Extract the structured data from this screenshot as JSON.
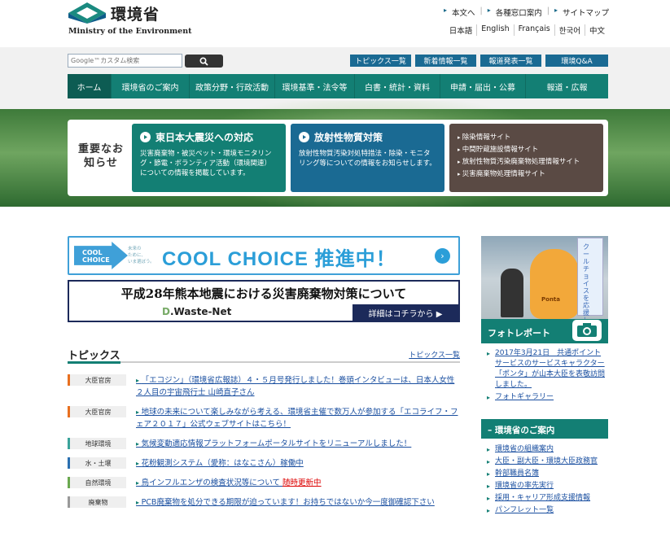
{
  "header": {
    "logo_jp": "環境省",
    "logo_en": "Ministry of the Environment",
    "top_links": [
      "本文へ",
      "各種窓口案内",
      "サイトマップ"
    ],
    "languages": [
      "日本語",
      "English",
      "Français",
      "한국어",
      "中文"
    ]
  },
  "search": {
    "placeholder": "Google™カスタム検索"
  },
  "quick_buttons": [
    "トピックス一覧",
    "新着情報一覧",
    "報道発表一覧",
    "環境Q&A"
  ],
  "nav": {
    "items": [
      "ホーム",
      "環境省のご案内",
      "政策分野・行政活動",
      "環境基準・法令等",
      "白書・統計・資料",
      "申請・届出・公募",
      "報道・広報"
    ]
  },
  "notice": {
    "label": "重要なお知らせ",
    "cards": [
      {
        "title": "東日本大震災への対応",
        "desc": "災害廃棄物・被災ペット・環境モニタリング・節電・ボランティア活動（環境関連）についての情報を掲載しています。",
        "color": "#137f74"
      },
      {
        "title": "放射性物質対策",
        "desc": "放射性物質汚染対処特措法・除染・モニタリング等についての情報をお知らせします。",
        "color": "#1a6a93"
      }
    ],
    "links": [
      "除染情報サイト",
      "中間貯蔵施設情報サイト",
      "放射性物質汚染廃棄物処理情報サイト",
      "災害廃棄物処理情報サイト"
    ],
    "links_color": "#5a4a44"
  },
  "cool_choice": {
    "arrow_text_1": "COOL",
    "arrow_text_2": "CHOICE",
    "small_1": "未来の",
    "small_2": "ために、",
    "small_3": "いま選ぼう。",
    "headline": "COOL CHOICE 推進中！"
  },
  "quake_banner": {
    "title": "平成28年熊本地震における災害廃棄物対策について",
    "logo_d": "D",
    "logo_rest": ".Waste-Net",
    "detail": "詳細はコチラから ▶"
  },
  "topics": {
    "heading": "トピックス",
    "all_link": "トピックス一覧",
    "items": [
      {
        "tag": "大臣官房",
        "text": "「エコジン」（環境省広報誌）４・５月号発行しました！巻頭インタビューは、日本人女性２人目の宇宙飛行士 山崎直子さん",
        "tag_color": "#e87020"
      },
      {
        "tag": "大臣官房",
        "text": "地球の未来について楽しみながら考える、環境省主催で数万人が参加する「エコライフ・フェア２０１７」公式ウェブサイトはこちら！",
        "tag_color": "#e87020"
      },
      {
        "tag": "地球環境",
        "text": "気候変動適応情報プラットフォームポータルサイトをリニューアルしました！",
        "tag_color": "#3aa39a"
      },
      {
        "tag": "水・土壌",
        "text": "花粉観測システム（愛称：はなこさん）稼働中",
        "tag_color": "#2a6fb0"
      },
      {
        "tag": "自然環境",
        "text": "鳥インフルエンザの検査状況等について",
        "extra": "随時更新中",
        "tag_color": "#6aa84f"
      },
      {
        "tag": "廃棄物",
        "text": "PCB廃棄物を処分できる期限が迫っています！お持ちではないか今一度御確認下さい",
        "tag_color": "#999999"
      }
    ]
  },
  "photo_report": {
    "label": "フォトレポート",
    "flag_text": "クールチョイスを応援しています",
    "mascot_label": "Ponta",
    "links": [
      "2017年3月21日　共通ポイントサービスのサービスキャラクター「ポンタ」が山本大臣を表敬訪問しました。",
      "フォトギャラリー"
    ]
  },
  "guide": {
    "heading": "環境省のご案内",
    "links": [
      "環境省の組織案内",
      "大臣・副大臣・環境大臣政務官",
      "幹部職員名簿",
      "環境省の率先実行",
      "採用・キャリア形成支援情報",
      "パンフレット一覧"
    ]
  }
}
